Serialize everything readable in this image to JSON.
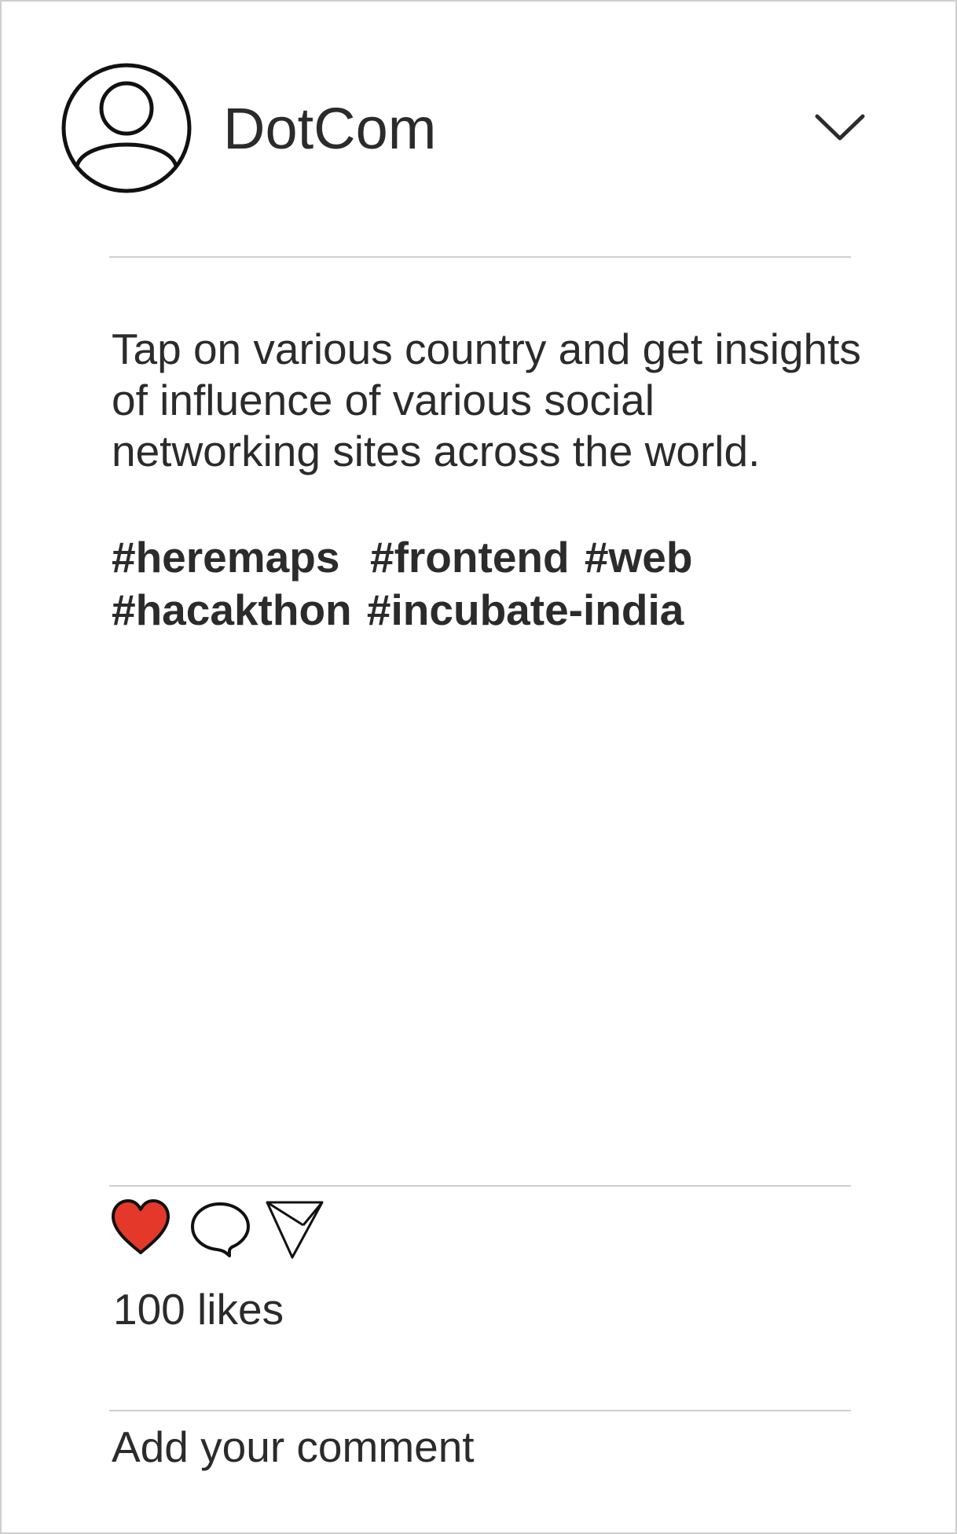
{
  "post": {
    "author": {
      "name": "DotCom",
      "avatar_icon": "user-avatar-icon"
    },
    "menu_icon": "chevron-down-icon",
    "caption": "Tap on various country and get insights of influence of various social networking sites across the world.",
    "hashtags": {
      "line1": "#heremaps  #frontend #web",
      "line2": "#hacakthon #incubate-india"
    },
    "actions": {
      "like_icon": "heart-icon",
      "comment_icon": "speech-bubble-icon",
      "share_icon": "send-icon",
      "liked": true,
      "like_color": "#e3382a"
    },
    "likes_text": "100 likes",
    "comment": {
      "placeholder": "Add your comment",
      "value": ""
    }
  },
  "colors": {
    "text": "#2b2b2b",
    "divider": "#cfcfcf",
    "border": "#cfcfcf",
    "background": "#ffffff"
  }
}
